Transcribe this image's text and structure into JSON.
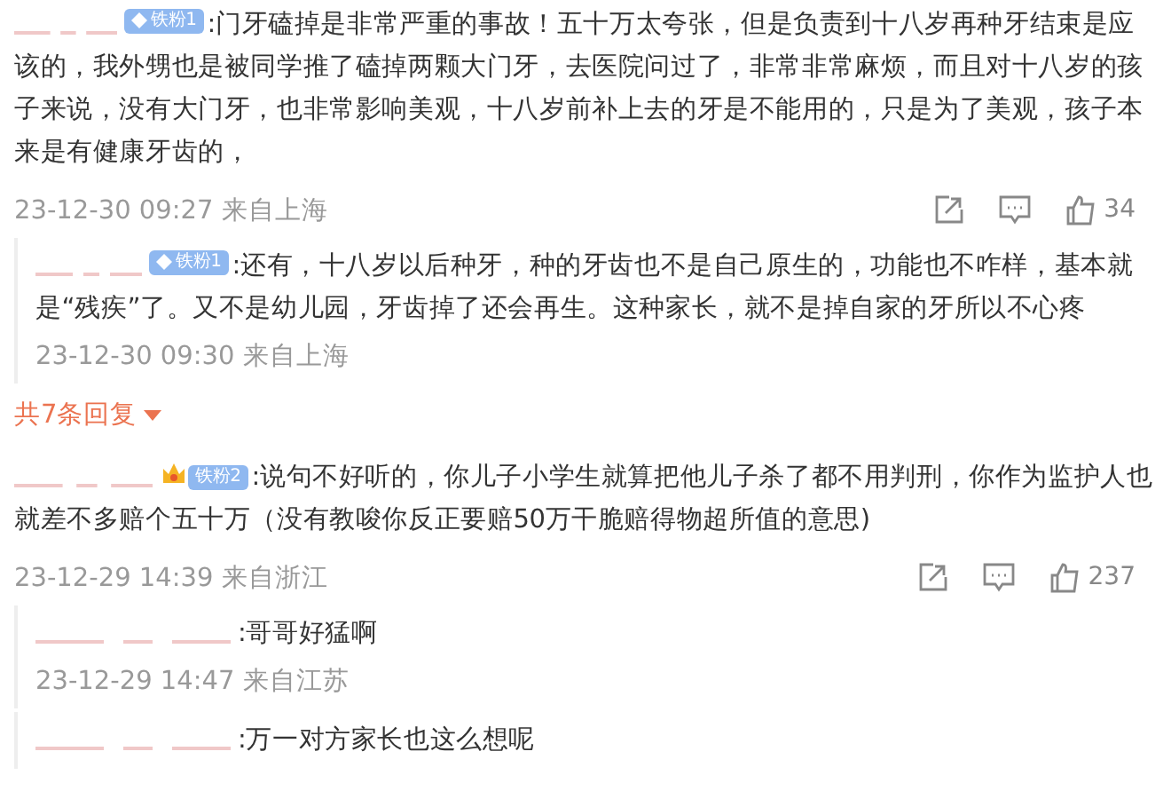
{
  "comments": [
    {
      "badge": {
        "kind": "fan",
        "label": "铁粉1"
      },
      "text": ":门牙磕掉是非常严重的事故！五十万太夸张，但是负责到十八岁再种牙结束是应该的，我外甥也是被同学推了磕掉两颗大门牙，去医院问过了，非常非常麻烦，而且对十八岁的孩子来说，没有大门牙，也非常影响美观，十八岁前补上去的牙是不能用的，只是为了美观，孩子本来是有健康牙齿的，",
      "time": "23-12-30 09:27",
      "location": "来自上海",
      "likes": "34",
      "replies": [
        {
          "badge": {
            "kind": "fan",
            "label": "铁粉1"
          },
          "text": ":还有，十八岁以后种牙，种的牙齿也不是自己原生的，功能也不咋样，基本就是“残疾”了。又不是幼儿园，牙齿掉了还会再生。这种家长，就不是掉自家的牙所以不心疼",
          "time": "23-12-30 09:30",
          "location": "来自上海"
        }
      ],
      "more_replies": "共7条回复"
    },
    {
      "badge": {
        "kind": "crown",
        "label": "铁粉2"
      },
      "text": ":说句不好听的，你儿子小学生就算把他儿子杀了都不用判刑，你作为监护人也就差不多赔个五十万（没有教唆你反正要赔50万干脆赔得物超所值的意思)",
      "time": "23-12-29 14:39",
      "location": "来自浙江",
      "likes": "237",
      "replies": [
        {
          "text": ":哥哥好猛啊",
          "time": "23-12-29 14:47",
          "location": "来自江苏"
        },
        {
          "text": ":万一对方家长也这么想呢"
        }
      ]
    }
  ]
}
